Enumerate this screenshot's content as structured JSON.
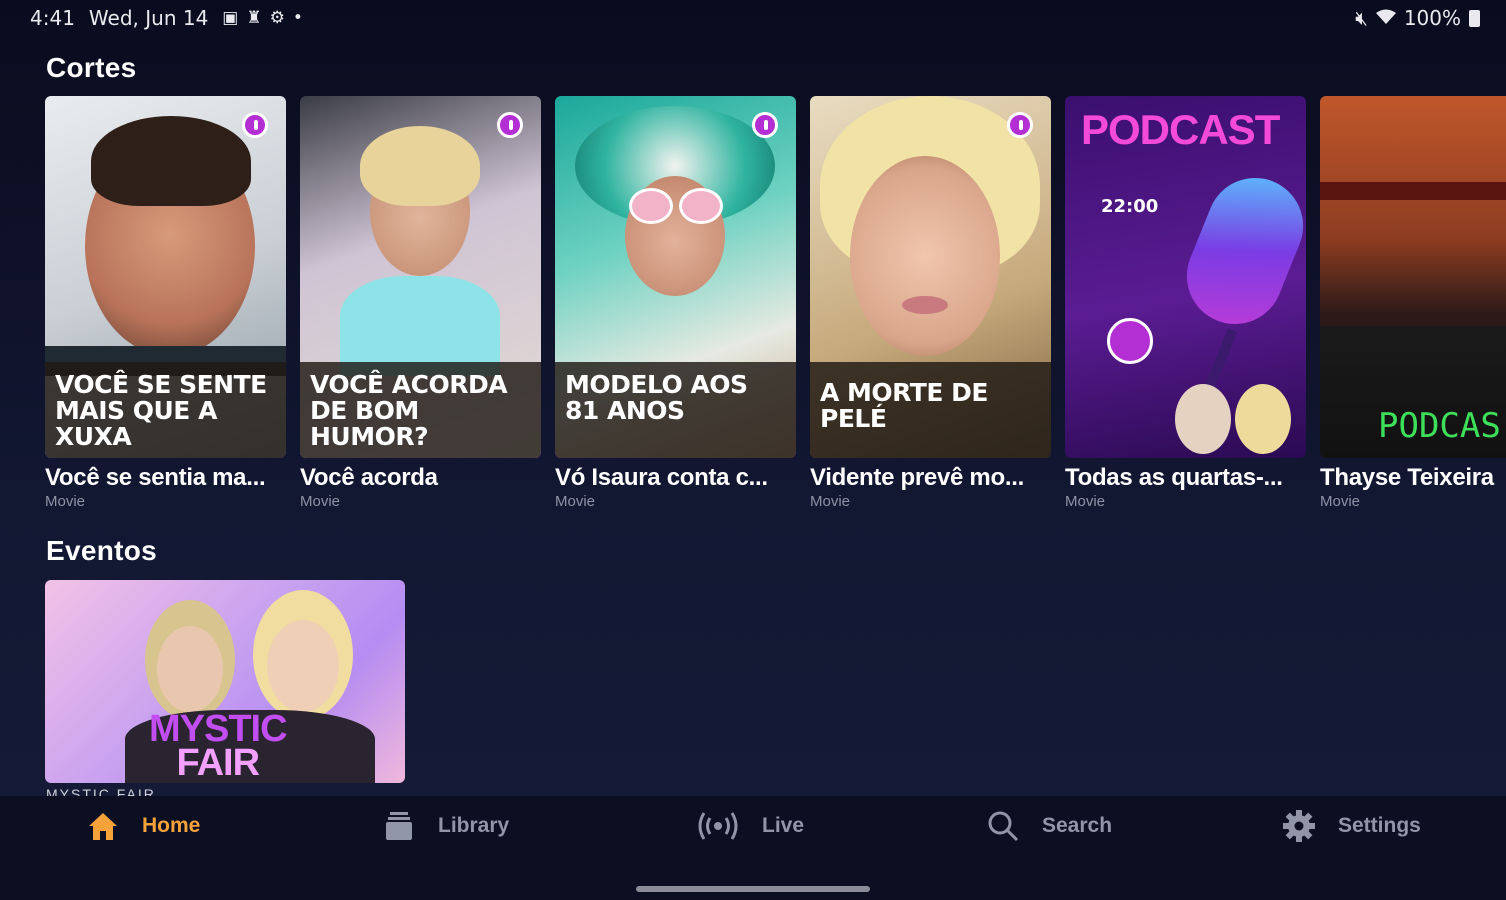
{
  "status_bar": {
    "time": "4:41",
    "date": "Wed, Jun 14",
    "battery": "100%"
  },
  "sections": {
    "cortes": {
      "title": "Cortes",
      "cards": [
        {
          "overlay": "VOCÊ SE SENTE MAIS QUE A XUXA",
          "title": "Você se sentia ma...",
          "subtitle": "Movie"
        },
        {
          "overlay": "VOCÊ ACORDA DE BOM HUMOR?",
          "title": "Você acorda",
          "subtitle": "Movie"
        },
        {
          "overlay": "MODELO AOS 81 ANOS",
          "title": "Vó Isaura conta c...",
          "subtitle": "Movie"
        },
        {
          "overlay": "A MORTE DE PELÉ",
          "title": "Vidente prevê mo...",
          "subtitle": "Movie"
        },
        {
          "overlay": "PODCAST",
          "time": "22:00",
          "title": "Todas as quartas-...",
          "subtitle": "Movie"
        },
        {
          "overlay": "PODCAS",
          "title": "Thayse Teixeira",
          "subtitle": "Movie"
        }
      ]
    },
    "eventos": {
      "title": "Eventos",
      "card": {
        "line1": "MYSTIC",
        "line2": "FAIR",
        "caption": "MYSTIC FAIR"
      }
    }
  },
  "nav": {
    "home": "Home",
    "library": "Library",
    "live": "Live",
    "search": "Search",
    "settings": "Settings"
  },
  "colors": {
    "accent": "#f5a23a",
    "background": "#0a0b1e",
    "brand_purple": "#b32fd3"
  }
}
